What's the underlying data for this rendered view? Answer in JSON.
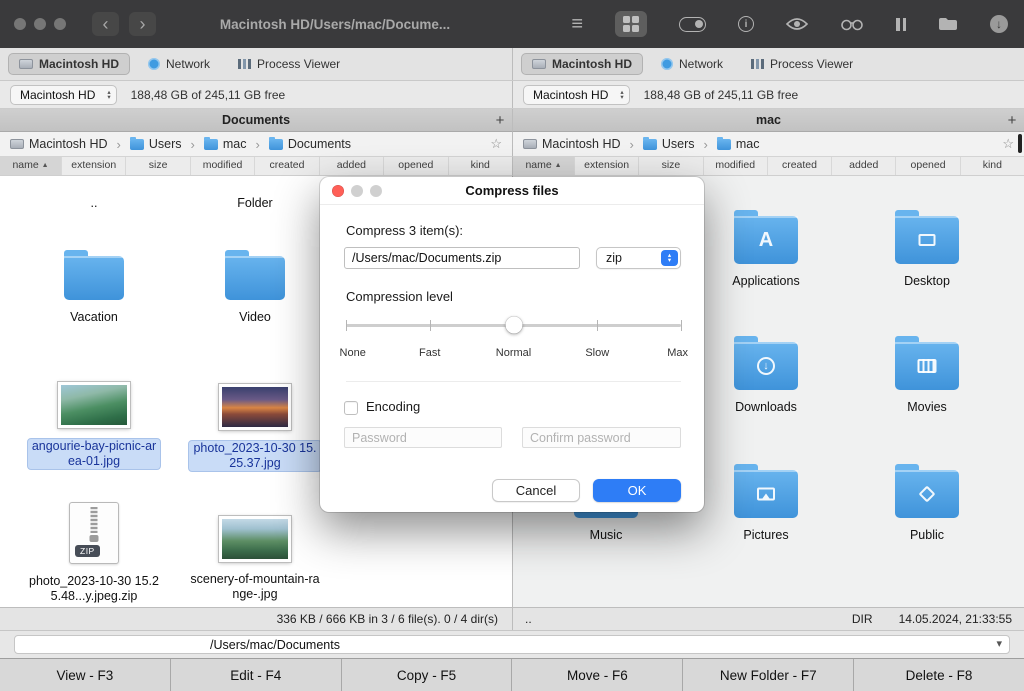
{
  "icons": {
    "back": "‹",
    "forward": "›",
    "crumb_sep": "›",
    "favorite": "☆",
    "add_tab": "+",
    "sort_asc": "▲",
    "dropdown": "▾",
    "stepper_up": "▴",
    "stepper_down": "▾",
    "list": "≡",
    "info": "i"
  },
  "toolbar": {
    "title": "Macintosh HD/Users/mac/Docume..."
  },
  "left": {
    "tabs": [
      "Macintosh HD",
      "Network",
      "Process Viewer"
    ],
    "drive": "Macintosh HD",
    "free": "188,48 GB of 245,11 GB free",
    "title": "Documents",
    "crumbs": [
      "Macintosh HD",
      "Users",
      "mac",
      "Documents"
    ],
    "columns": [
      "name",
      "extension",
      "size",
      "modified",
      "created",
      "added",
      "opened",
      "kind"
    ],
    "items": {
      "up": "..",
      "up_kind": "Folder",
      "vacation": "Vacation",
      "video": "Video",
      "img1": "angourie-bay-picnic-area-01.jpg",
      "img2": "photo_2023-10-30 15.25.37.jpg",
      "zip": "photo_2023-10-30 15.25.48...y.jpeg.zip",
      "zip_badge": "ZIP",
      "img3": "scenery-of-mountain-range-.jpg"
    },
    "status": "336 KB / 666 KB in 3 / 6 file(s). 0 / 4 dir(s)"
  },
  "right": {
    "tabs": [
      "Macintosh HD",
      "Network",
      "Process Viewer"
    ],
    "drive": "Macintosh HD",
    "free": "188,48 GB of 245,11 GB free",
    "title": "mac",
    "crumbs": [
      "Macintosh HD",
      "Users",
      "mac"
    ],
    "columns": [
      "name",
      "extension",
      "size",
      "modified",
      "created",
      "added",
      "opened",
      "kind"
    ],
    "items": {
      "applications": "Applications",
      "desktop": "Desktop",
      "downloads": "Downloads",
      "movies": "Movies",
      "music": "Music",
      "pictures": "Pictures",
      "public": "Public"
    },
    "status": {
      "name": "..",
      "kind": "DIR",
      "date": "14.05.2024, 21:33:55"
    }
  },
  "dialog": {
    "title": "Compress files",
    "prompt": "Compress 3 item(s):",
    "filename": "/Users/mac/Documents.zip",
    "format": "zip",
    "level_label": "Compression level",
    "levels": [
      "None",
      "Fast",
      "Normal",
      "Slow",
      "Max"
    ],
    "selected_level": "Normal",
    "encoding_label": "Encoding",
    "password_placeholder": "Password",
    "confirm_placeholder": "Confirm password",
    "cancel_label": "Cancel",
    "ok_label": "OK"
  },
  "pathbar": {
    "path": "/Users/mac/Documents"
  },
  "fkeys": {
    "f3": "View - F3",
    "f4": "Edit - F4",
    "f5": "Copy - F5",
    "f6": "Move - F6",
    "f7": "New Folder - F7",
    "f8": "Delete - F8"
  }
}
